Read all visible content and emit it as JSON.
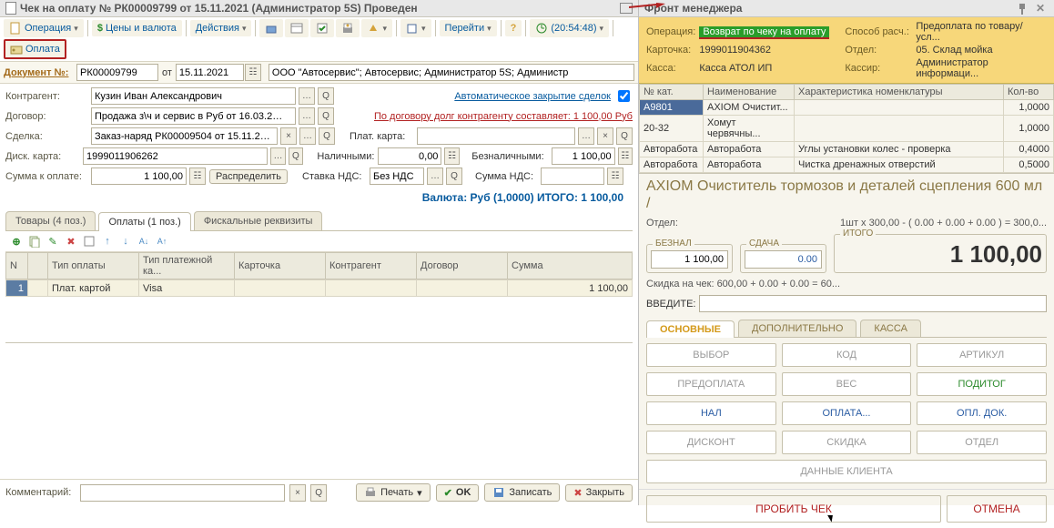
{
  "left": {
    "title": "Чек на оплату № РК00009799 от 15.11.2021 (Администратор 5S) Проведен",
    "toolbar": {
      "operation": "Операция",
      "prices": "Цены и валюта",
      "actions": "Действия",
      "goto": "Перейти",
      "time": "(20:54:48)",
      "pay": "Оплата"
    },
    "docnum_label": "Документ №:",
    "docnum": "РК00009799",
    "ot": "от",
    "docdate": "15.11.2021",
    "org": "ООО \"Автосервис\"; Автосервис; Администратор 5S; Администр",
    "rows": {
      "contragent_label": "Контрагент:",
      "contragent": "Кузин Иван Александрович",
      "auto_close": "Автоматическое закрытие сделок",
      "dogovor_label": "Договор:",
      "dogovor": "Продажа з\\ч и сервис в Руб от 16.03.2…",
      "dolg_link": "По договору долг контрагенту составляет: 1 100,00 Руб",
      "sdelka_label": "Сделка:",
      "sdelka": "Заказ-наряд РК00009504 от 15.11.2…",
      "plat_karta_label": "Плат. карта:",
      "plat_karta": "",
      "disk_karta_label": "Диск. карта:",
      "disk_karta": "1999011906262",
      "nal_label": "Наличными:",
      "nal": "0,00",
      "beznal_label": "Безналичными:",
      "beznal": "1 100,00",
      "summa_label": "Сумма к оплате:",
      "summa": "1 100,00",
      "raspredelit": "Распределить",
      "nds_label": "Ставка НДС:",
      "nds": "Без НДС",
      "summa_nds_label": "Сумма НДС:",
      "summa_nds": ""
    },
    "totals": "Валюта: Руб (1,0000) ИТОГО: 1 100,00",
    "tabs": {
      "t1": "Товары (4 поз.)",
      "t2": "Оплаты (1 поз.)",
      "t3": "Фискальные реквизиты"
    },
    "grid": {
      "h_n": "N",
      "h_tip": "Тип оплаты",
      "h_plat": "Тип платежной ка...",
      "h_kart": "Карточка",
      "h_contr": "Контрагент",
      "h_dog": "Договор",
      "h_sum": "Сумма",
      "r1_n": "1",
      "r1_tip": "Плат. картой",
      "r1_plat": "Visa",
      "r1_sum": "1 100,00"
    },
    "comment_label": "Комментарий:",
    "print": "Печать",
    "ok": "OK",
    "save": "Записать",
    "close": "Закрыть"
  },
  "right": {
    "title": "Фронт менеджера",
    "header": {
      "operation_l": "Операция:",
      "operation_v": "Возврат по чеку на оплату",
      "sposob_l": "Способ расч.:",
      "sposob_v": "Предоплата по товару/усл...",
      "kart_l": "Карточка:",
      "kart_v": "1999011904362",
      "otdel_l": "Отдел:",
      "otdel_v": "05. Склад мойка",
      "kassa_l": "Касса:",
      "kassa_v": "Касса АТОЛ ИП",
      "kassir_l": "Кассир:",
      "kassir_v": "Администратор информаци..."
    },
    "grid": {
      "h1": "№ кат.",
      "h2": "Наименование",
      "h3": "Характеристика номенклатуры",
      "h4": "Кол-во",
      "rows": [
        {
          "c1": "A9801",
          "c2": "AXIOM Очистит...",
          "c3": "",
          "c4": "1,0000"
        },
        {
          "c1": "20-32",
          "c2": "Хомут червячны...",
          "c3": "",
          "c4": "1,0000"
        },
        {
          "c1": "Авторабота",
          "c2": "Авторабота",
          "c3": "Углы установки колес - проверка",
          "c4": "0,4000"
        },
        {
          "c1": "Авторабота",
          "c2": "Авторабота",
          "c3": "Чистка дренажных отверстий",
          "c4": "0,5000"
        }
      ]
    },
    "detail": {
      "title": "AXIOM Очиститель тормозов и деталей сцепления 600 мл /",
      "otdel_l": "Отдел:",
      "otdel_r": "1шт x 300,00 - ( 0.00 + 0.00 + 0.00 ) = 300,0...",
      "beznap_legend": "БЕЗНАЛ",
      "beznap": "1 100,00",
      "sdacha_legend": "СДАЧА",
      "sdacha": "0.00",
      "itogo_legend": "ИТОГО",
      "itogo": "1 100,00",
      "skidka": "Скидка на чек:  600,00 + 0.00 + 0.00 = 60...",
      "enter": "ВВЕДИТЕ:"
    },
    "rtabs": {
      "t1": "ОСНОВНЫЕ",
      "t2": "ДОПОЛНИТЕЛЬНО",
      "t3": "КАССА"
    },
    "buttons": {
      "vybor": "ВЫБОР",
      "kod": "КОД",
      "artikul": "АРТИКУЛ",
      "pred": "ПРЕДОПЛАТА",
      "ves": "ВЕС",
      "poditog": "ПОДИТОГ",
      "nal": "НАЛ",
      "oplata": "ОПЛАТА...",
      "opldok": "ОПЛ. ДОК.",
      "diskont": "ДИСКОНТ",
      "skidka": "СКИДКА",
      "otdel": "ОТДЕЛ",
      "client": "ДАННЫЕ КЛИЕНТА",
      "probity": "ПРОБИТЬ ЧЕК",
      "otmena": "ОТМЕНА"
    }
  }
}
